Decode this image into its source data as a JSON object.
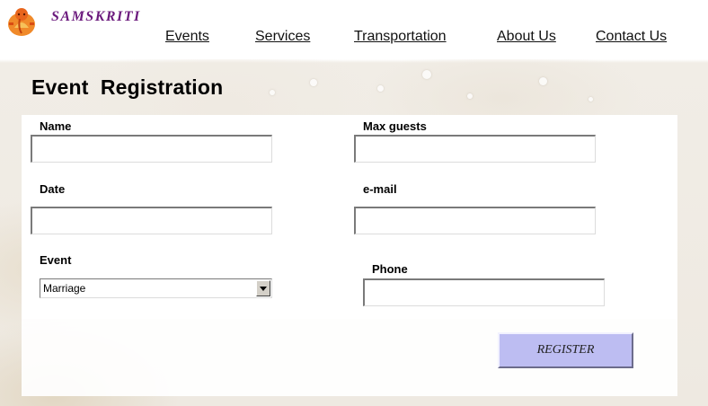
{
  "header": {
    "brand": "SAMSKRITI",
    "logo_icon": "ganesha-logo-icon",
    "nav": [
      {
        "label": "Events",
        "active": true
      },
      {
        "label": "Services"
      },
      {
        "label": "Transportation"
      },
      {
        "label": "About Us"
      },
      {
        "label": "Contact Us"
      }
    ]
  },
  "page": {
    "title": "Event  Registration"
  },
  "form": {
    "name": {
      "label": "Name",
      "value": ""
    },
    "max_guests": {
      "label": "Max guests",
      "value": ""
    },
    "date": {
      "label": "Date",
      "value": ""
    },
    "email": {
      "label": "e-mail",
      "value": ""
    },
    "event": {
      "label": "Event",
      "selected": "Marriage"
    },
    "phone": {
      "label": "Phone",
      "value": ""
    },
    "submit_label": "REGISTER"
  },
  "colors": {
    "brand": "#6b1a7d",
    "register_button": "#bdbdf2"
  }
}
